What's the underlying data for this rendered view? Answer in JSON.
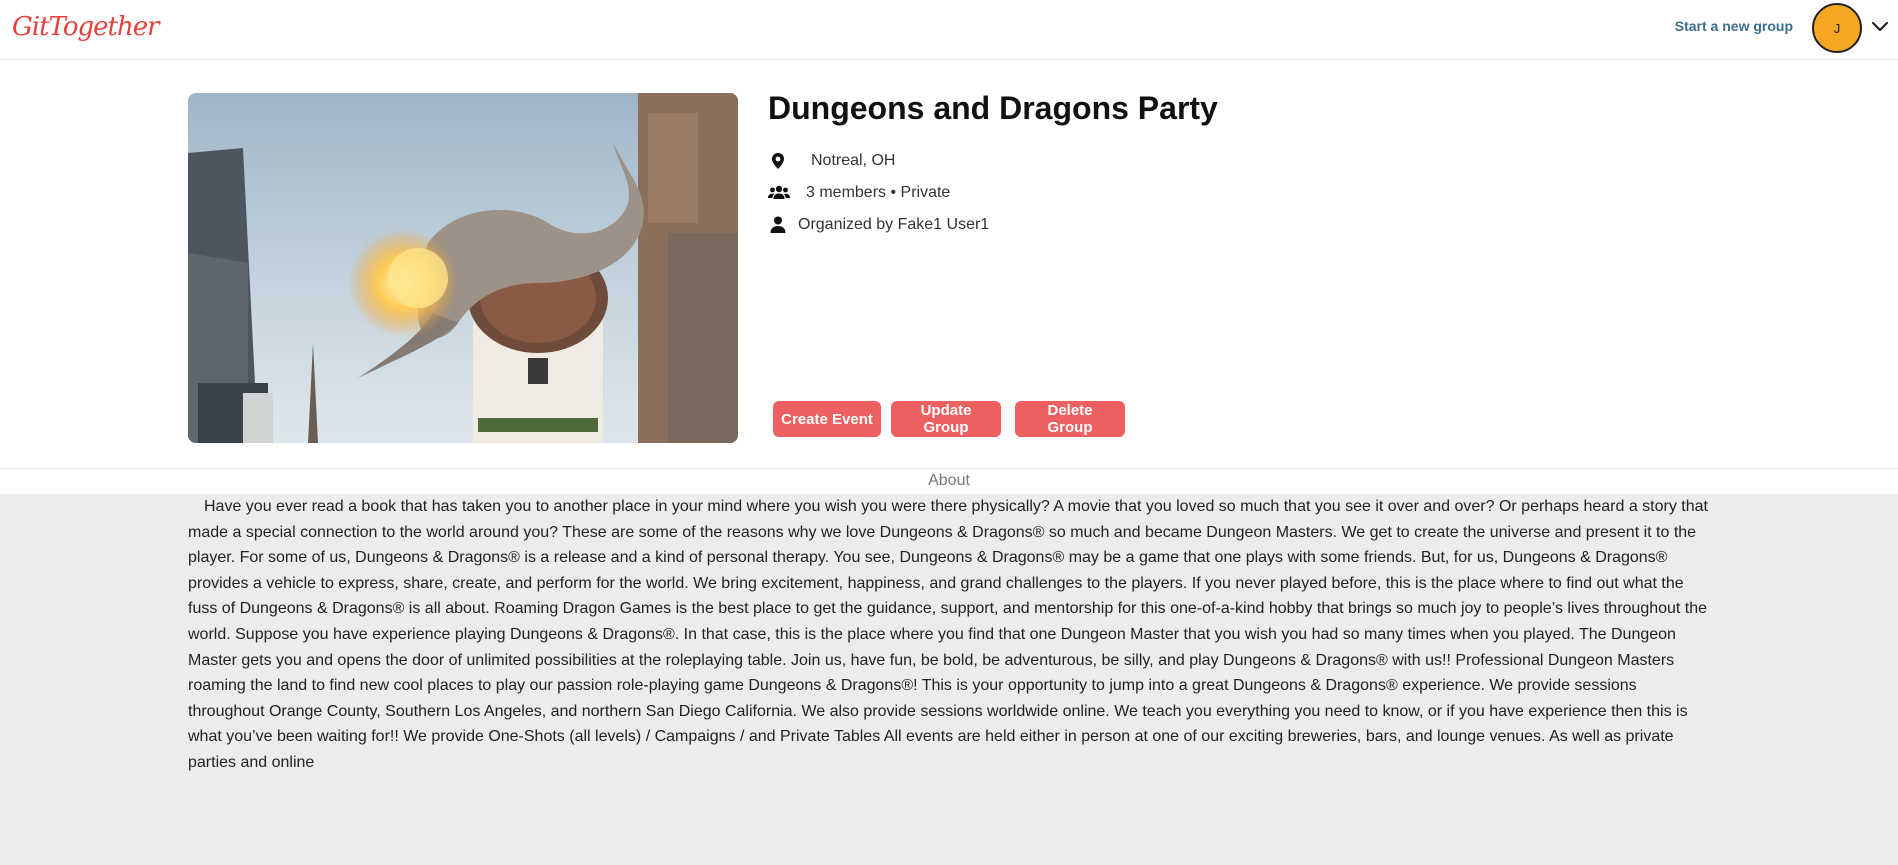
{
  "header": {
    "logo": "GitTogether",
    "start_group_label": "Start a new group",
    "avatar_initial": "J"
  },
  "group": {
    "title": "Dungeons and Dragons Party",
    "location": "Notreal, OH",
    "members": "3 members • Private",
    "organizer": "Organized by Fake1 User1"
  },
  "actions": {
    "create_event": "Create Event",
    "update_group": "Update Group",
    "delete_group": "Delete Group"
  },
  "about": {
    "tab_label": "About",
    "text": "Have you ever read a book that has taken you to another place in your mind where you wish you were there physically? A movie that you loved so much that you see it over and over? Or perhaps heard a story that made a special connection to the world around you? These are some of the reasons why we love Dungeons & Dragons® so much and became Dungeon Masters. We get to create the universe and present it to the player. For some of us, Dungeons & Dragons® is a release and a kind of personal therapy. You see, Dungeons & Dragons® may be a game that one plays with some friends. But, for us, Dungeons & Dragons® provides a vehicle to express, share, create, and perform for the world. We bring excitement, happiness, and grand challenges to the players. If you never played before, this is the place where to find out what the fuss of Dungeons & Dragons® is all about. Roaming Dragon Games is the best place to get the guidance, support, and mentorship for this one-of-a-kind hobby that brings so much joy to people’s lives throughout the world. Suppose you have experience playing Dungeons & Dragons®. In that case, this is the place where you find that one Dungeon Master that you wish you had so many times when you played. The Dungeon Master gets you and opens the door of unlimited possibilities at the roleplaying table. Join us, have fun, be bold, be adventurous, be silly, and play Dungeons & Dragons® with us!! Professional Dungeon Masters roaming the land to find new cool places to play our passion role-playing game Dungeons & Dragons®! This is your opportunity to jump into a great Dungeons & Dragons® experience. We provide sessions throughout Orange County, Southern Los Angeles, and northern San Diego California. We also provide sessions worldwide online. We teach you everything you need to know, or if you have experience then this is what you’ve been waiting for!! We provide One-Shots (all levels) / Campaigns / and Private Tables All events are held either in person at one of our exciting breweries, bars, and lounge venues. As well as private parties and online"
  },
  "colors": {
    "brand": "#e8403a",
    "button": "#ec6060",
    "avatar": "#f5a623",
    "link": "#3a6f8f",
    "about_bg": "#ececec"
  },
  "icons": [
    "map-pin-icon",
    "users-icon",
    "user-icon",
    "chevron-down-icon"
  ]
}
